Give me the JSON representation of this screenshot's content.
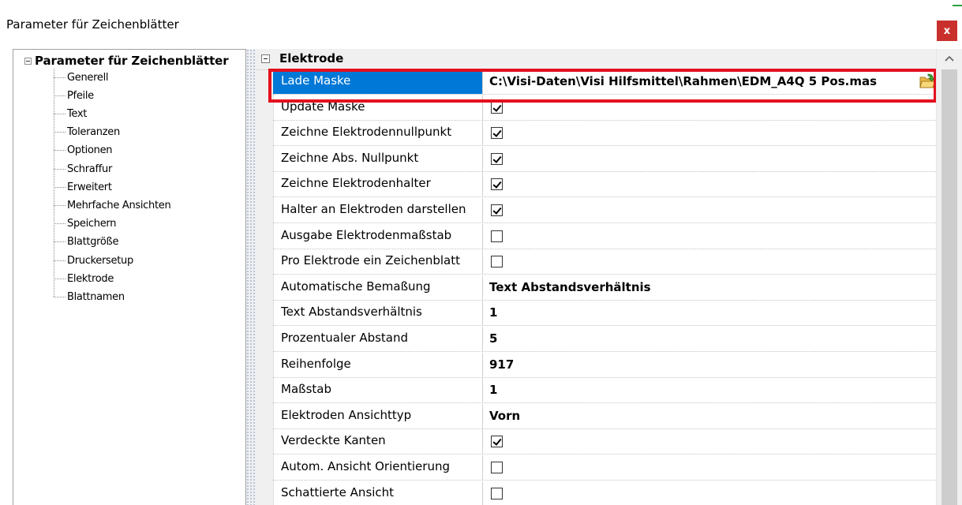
{
  "window": {
    "title": "Parameter für Zeichenblätter",
    "close_label": "x"
  },
  "tree": {
    "root_label": "Parameter für Zeichenblätter",
    "items": [
      {
        "label": "Generell"
      },
      {
        "label": "Pfeile"
      },
      {
        "label": "Text"
      },
      {
        "label": "Toleranzen"
      },
      {
        "label": "Optionen"
      },
      {
        "label": "Schraffur"
      },
      {
        "label": "Erweitert"
      },
      {
        "label": "Mehrfache Ansichten"
      },
      {
        "label": "Speichern"
      },
      {
        "label": "Blattgröße"
      },
      {
        "label": "Druckersetup"
      },
      {
        "label": "Elektrode"
      },
      {
        "label": "Blattnamen"
      }
    ]
  },
  "grid": {
    "category": "Elektrode",
    "rows": [
      {
        "name": "Lade Maske",
        "type": "path",
        "value": "C:\\Visi-Daten\\Visi Hilfsmittel\\Rahmen\\EDM_A4Q 5 Pos.mas",
        "icon": "folder-open-icon",
        "selected": true
      },
      {
        "name": "Update Maske",
        "type": "checkbox",
        "checked": true
      },
      {
        "name": "Zeichne Elektrodennullpunkt",
        "type": "checkbox",
        "checked": true
      },
      {
        "name": "Zeichne Abs. Nullpunkt",
        "type": "checkbox",
        "checked": true
      },
      {
        "name": "Zeichne Elektrodenhalter",
        "type": "checkbox",
        "checked": true
      },
      {
        "name": "Halter an Elektroden darstellen",
        "type": "checkbox",
        "checked": true
      },
      {
        "name": "Ausgabe Elektrodenmaßstab",
        "type": "checkbox",
        "checked": false
      },
      {
        "name": "Pro Elektrode ein Zeichenblatt",
        "type": "checkbox",
        "checked": false
      },
      {
        "name": "Automatische Bemaßung",
        "type": "text",
        "value": "Text Abstandsverhältnis"
      },
      {
        "name": "Text Abstandsverhältnis",
        "type": "text",
        "value": "1"
      },
      {
        "name": "Prozentualer Abstand",
        "type": "text",
        "value": "5"
      },
      {
        "name": "Reihenfolge",
        "type": "text",
        "value": "917"
      },
      {
        "name": "Maßstab",
        "type": "text",
        "value": "1"
      },
      {
        "name": "Elektroden Ansichttyp",
        "type": "text",
        "value": "Vorn"
      },
      {
        "name": "Verdeckte Kanten",
        "type": "checkbox",
        "checked": true
      },
      {
        "name": "Autom. Ansicht Orientierung",
        "type": "checkbox",
        "checked": false
      },
      {
        "name": "Schattierte Ansicht",
        "type": "checkbox",
        "checked": false
      }
    ]
  },
  "colors": {
    "selection": "#0078d7",
    "highlight_border": "#e3101e",
    "close_button": "#c9302c"
  }
}
